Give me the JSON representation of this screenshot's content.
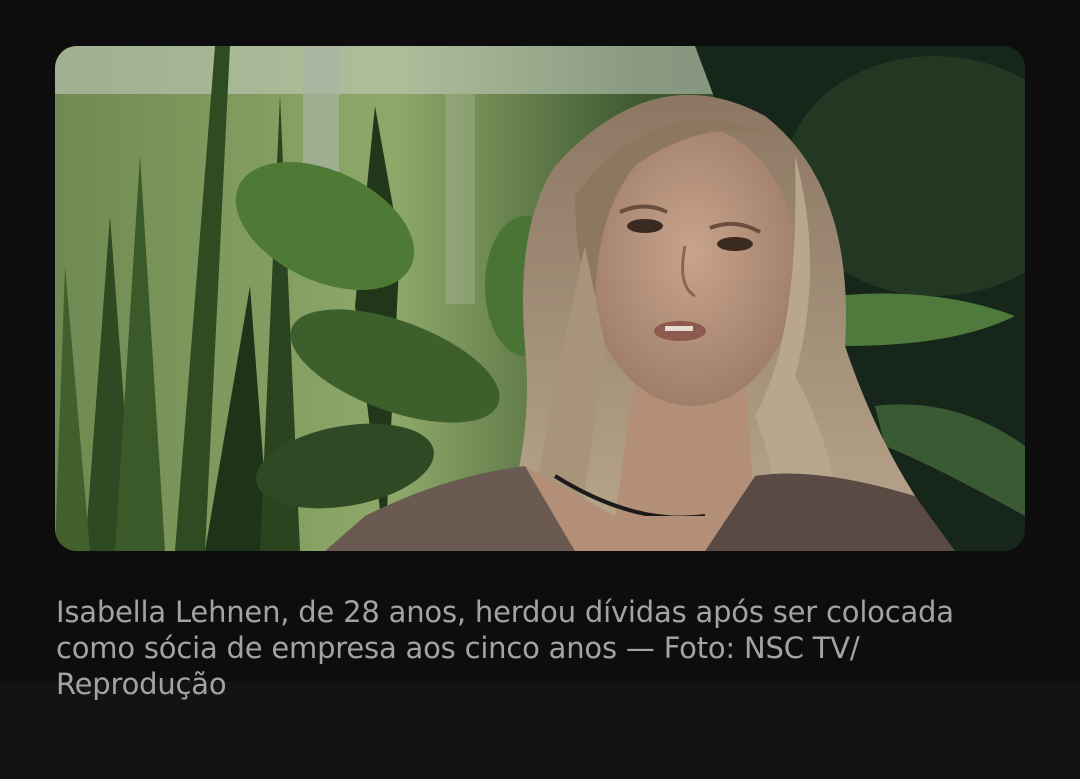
{
  "photo": {
    "subject": "woman-interview-photo"
  },
  "caption": {
    "text": "Isabella Lehnen, de 28 anos, herdou dívidas após ser colocada como sócia de empresa aos cinco anos — Foto: NSC TV/ Reprodução"
  },
  "colors": {
    "page_background": "#0d0d0d",
    "lower_band": "#131313",
    "caption_text": "#a3a3a3"
  }
}
